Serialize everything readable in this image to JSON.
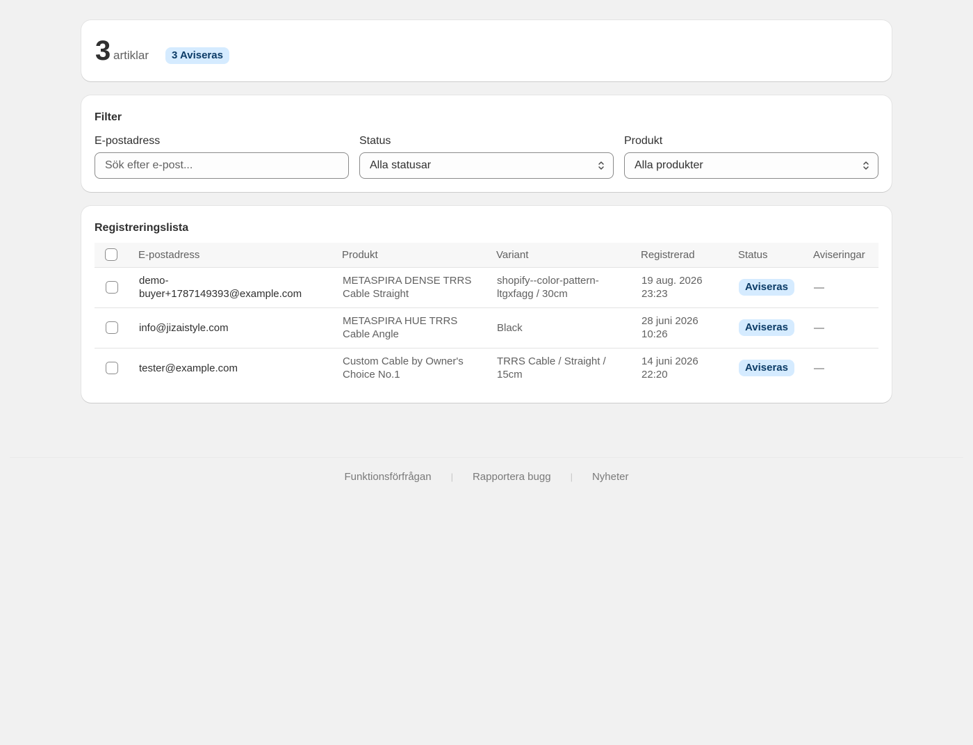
{
  "summary": {
    "count": "3",
    "count_label": "artiklar",
    "badge": "3 Aviseras"
  },
  "filter": {
    "title": "Filter",
    "email_label": "E-postadress",
    "email_placeholder": "Sök efter e-post...",
    "status_label": "Status",
    "status_value": "Alla statusar",
    "product_label": "Produkt",
    "product_value": "Alla produkter"
  },
  "list": {
    "title": "Registreringslista",
    "columns": [
      "E-postadress",
      "Produkt",
      "Variant",
      "Registrerad",
      "Status",
      "Aviseringar"
    ],
    "rows": [
      {
        "email": "demo-\nbuyer+1787149393@example.com",
        "product": "METASPIRA DENSE TRRS\nCable Straight",
        "variant": "shopify--color-pattern-\nltgxfagg / 30cm",
        "registered": "19 aug. 2026\n23:23",
        "status": "Aviseras",
        "notifications": "—"
      },
      {
        "email": "info@jizaistyle.com",
        "product": "METASPIRA HUE TRRS\nCable Angle",
        "variant": "Black",
        "registered": "28 juni 2026\n10:26",
        "status": "Aviseras",
        "notifications": "—"
      },
      {
        "email": "tester@example.com",
        "product": "Custom Cable by Owner's\nChoice No.1",
        "variant": "TRRS Cable / Straight /\n15cm",
        "registered": "14 juni 2026\n22:20",
        "status": "Aviseras",
        "notifications": "—"
      }
    ]
  },
  "footer": {
    "links": [
      "Funktionsförfrågan",
      "Rapportera bugg",
      "Nyheter"
    ],
    "separator": "|"
  }
}
